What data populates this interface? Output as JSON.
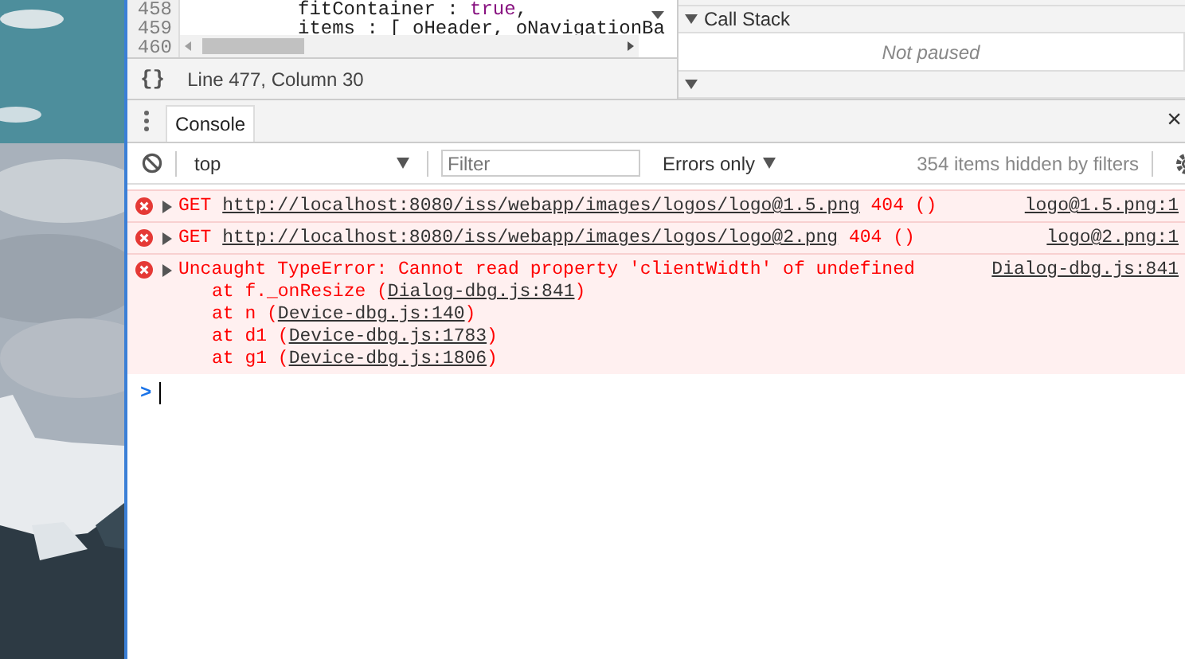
{
  "sources": {
    "code_lines": [
      {
        "number": "458",
        "tokens": [
          {
            "text": "fitContainer : ",
            "kind": "plain"
          },
          {
            "text": "true",
            "kind": "keyword"
          },
          {
            "text": ",",
            "kind": "plain"
          }
        ]
      },
      {
        "number": "459",
        "tokens": [
          {
            "text": "items : [ oHeader, oNavigationBa",
            "kind": "plain"
          }
        ]
      },
      {
        "number": "460"
      }
    ],
    "format_button": "{}",
    "cursor_position": "Line 477, Column 30"
  },
  "debugger": {
    "sections": [
      {
        "title": "Call Stack",
        "expanded": true,
        "body": "Not paused"
      },
      {
        "expanded": true
      }
    ]
  },
  "drawer": {
    "tabs": [
      {
        "label": "Console",
        "selected": true
      }
    ],
    "close": "×"
  },
  "console_toolbar": {
    "context": "top",
    "filter_placeholder": "Filter",
    "levels": "Errors only",
    "hidden_count": "354 items hidden by filters"
  },
  "messages": [
    {
      "is_error": true,
      "kind": "network",
      "method": "GET",
      "url": "http://localhost:8080/iss/webapp/images/logos/logo@1.5.png",
      "status": "404 ()",
      "source": "logo@1.5.png:1"
    },
    {
      "is_error": true,
      "kind": "network",
      "method": "GET",
      "url": "http://localhost:8080/iss/webapp/images/logos/logo@2.png",
      "status": "404 ()",
      "source": "logo@2.png:1"
    },
    {
      "is_error": true,
      "kind": "exception",
      "text": "Uncaught TypeError: Cannot read property 'clientWidth' of undefined",
      "source": "Dialog-dbg.js:841",
      "stack": [
        {
          "prefix": "at f._onResize (",
          "link": "Dialog-dbg.js:841",
          "suffix": ")"
        },
        {
          "prefix": "at n (",
          "link": "Device-dbg.js:140",
          "suffix": ")"
        },
        {
          "prefix": "at d1 (",
          "link": "Device-dbg.js:1783",
          "suffix": ")"
        },
        {
          "prefix": "at g1 (",
          "link": "Device-dbg.js:1806",
          "suffix": ")"
        }
      ]
    }
  ],
  "prompt": ">"
}
